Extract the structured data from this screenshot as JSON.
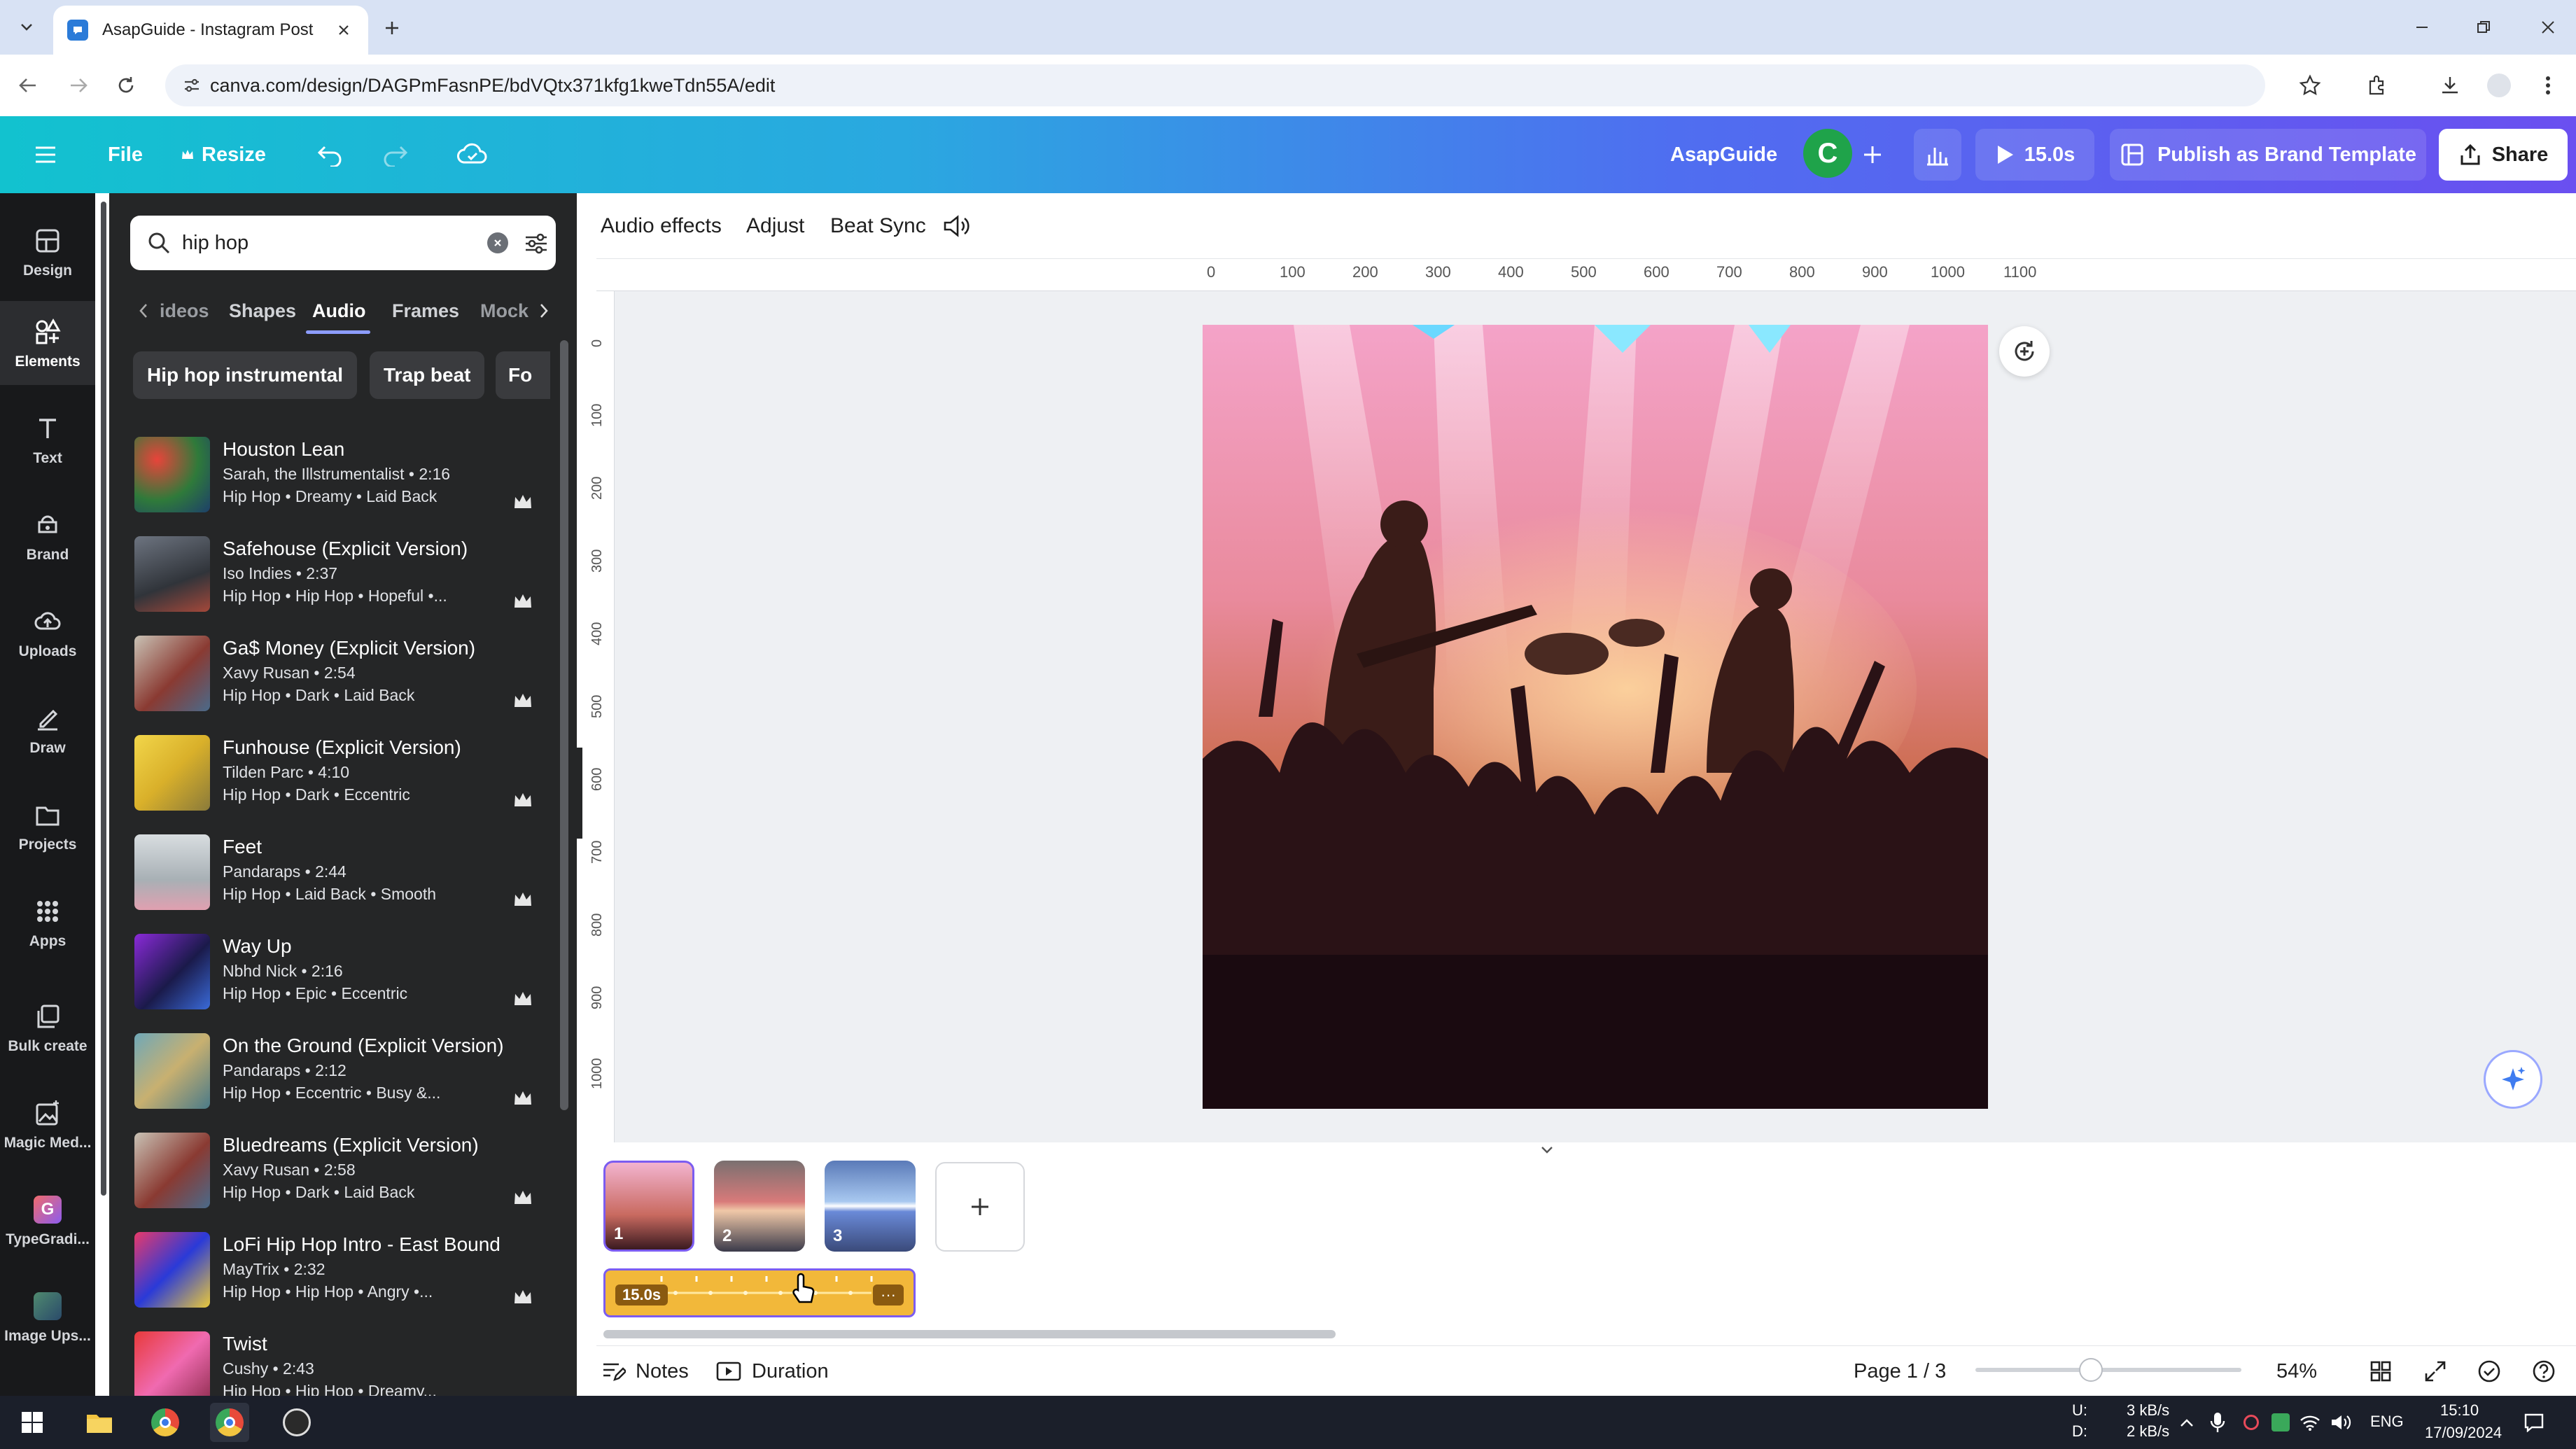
{
  "browser": {
    "tab_title": "AsapGuide - Instagram Post",
    "url": "canva.com/design/DAGPmFasnPE/bdVQtx371kfg1kweTdn55A/edit"
  },
  "topbar": {
    "file_label": "File",
    "resize_label": "Resize",
    "team_name": "AsapGuide",
    "avatar_letter": "C",
    "play_duration": "15.0s",
    "publish_label": "Publish as Brand Template",
    "share_label": "Share"
  },
  "rail": {
    "items": [
      {
        "label": "Design",
        "icon": "design-icon"
      },
      {
        "label": "Elements",
        "icon": "elements-icon"
      },
      {
        "label": "Text",
        "icon": "text-icon"
      },
      {
        "label": "Brand",
        "icon": "brand-icon"
      },
      {
        "label": "Uploads",
        "icon": "uploads-icon"
      },
      {
        "label": "Draw",
        "icon": "draw-icon"
      },
      {
        "label": "Projects",
        "icon": "projects-icon"
      },
      {
        "label": "Apps",
        "icon": "apps-icon"
      },
      {
        "label": "Bulk create",
        "icon": "bulk-create-icon"
      },
      {
        "label": "Magic Med...",
        "icon": "magic-media-icon"
      },
      {
        "label": "TypeGradi...",
        "icon": "typegradient-icon"
      },
      {
        "label": "Image Ups...",
        "icon": "image-upscaler-icon"
      }
    ]
  },
  "panel": {
    "search_value": "hip hop",
    "category_tabs": [
      "ideos",
      "Shapes",
      "Audio",
      "Frames",
      "Mock"
    ],
    "active_tab": "Audio",
    "chips": [
      "Hip hop instrumental",
      "Trap beat",
      "Fo"
    ],
    "tracks": [
      {
        "name": "Houston Lean",
        "artist_duration": "Sarah, the Illstrumentalist • 2:16",
        "tags": "Hip Hop • Dreamy • Laid Back"
      },
      {
        "name": "Safehouse (Explicit Version)",
        "artist_duration": "Iso Indies • 2:37",
        "tags": "Hip Hop • Hip Hop • Hopeful •..."
      },
      {
        "name": "Ga$ Money (Explicit Version)",
        "artist_duration": "Xavy Rusan • 2:54",
        "tags": "Hip Hop • Dark • Laid Back"
      },
      {
        "name": "Funhouse (Explicit Version)",
        "artist_duration": "Tilden Parc • 4:10",
        "tags": "Hip Hop • Dark • Eccentric"
      },
      {
        "name": "Feet",
        "artist_duration": "Pandaraps • 2:44",
        "tags": "Hip Hop • Laid Back • Smooth"
      },
      {
        "name": "Way Up",
        "artist_duration": "Nbhd Nick • 2:16",
        "tags": "Hip Hop • Epic • Eccentric"
      },
      {
        "name": "On the Ground (Explicit Version)",
        "artist_duration": "Pandaraps • 2:12",
        "tags": "Hip Hop • Eccentric • Busy &..."
      },
      {
        "name": "Bluedreams (Explicit Version)",
        "artist_duration": "Xavy Rusan • 2:58",
        "tags": "Hip Hop • Dark • Laid Back"
      },
      {
        "name": "LoFi Hip Hop Intro - East Bound",
        "artist_duration": "MayTrix • 2:32",
        "tags": "Hip Hop • Hip Hop • Angry •..."
      },
      {
        "name": "Twist",
        "artist_duration": "Cushy • 2:43",
        "tags": "Hip Hop • Hip Hop • Dreamy..."
      }
    ]
  },
  "context_bar": {
    "audio_effects": "Audio effects",
    "adjust": "Adjust",
    "beat_sync": "Beat Sync"
  },
  "rulers": {
    "horizontal": [
      "0",
      "100",
      "200",
      "300",
      "400",
      "500",
      "600",
      "700",
      "800",
      "900",
      "1000",
      "1100"
    ],
    "vertical": [
      "0",
      "100",
      "200",
      "300",
      "400",
      "500",
      "600",
      "700",
      "800",
      "900",
      "1000"
    ]
  },
  "timeline": {
    "pages": [
      "1",
      "2",
      "3"
    ],
    "audio_duration": "15.0s"
  },
  "statusbar": {
    "notes_label": "Notes",
    "duration_label": "Duration",
    "page_indicator": "Page 1 / 3",
    "zoom": "54%"
  },
  "taskbar": {
    "net_up_label": "U:",
    "net_down_label": "D:",
    "net_up": "3 kB/s",
    "net_down": "2 kB/s",
    "lang": "ENG",
    "time": "15:10",
    "date": "17/09/2024"
  },
  "colors": {
    "canva_gradient_start": "#12c2cf",
    "canva_gradient_end": "#6a4ff0",
    "panel_bg": "#252627",
    "rail_bg": "#18191b",
    "audio_strip": "#f2b83a",
    "selection": "#7b5cf0"
  }
}
